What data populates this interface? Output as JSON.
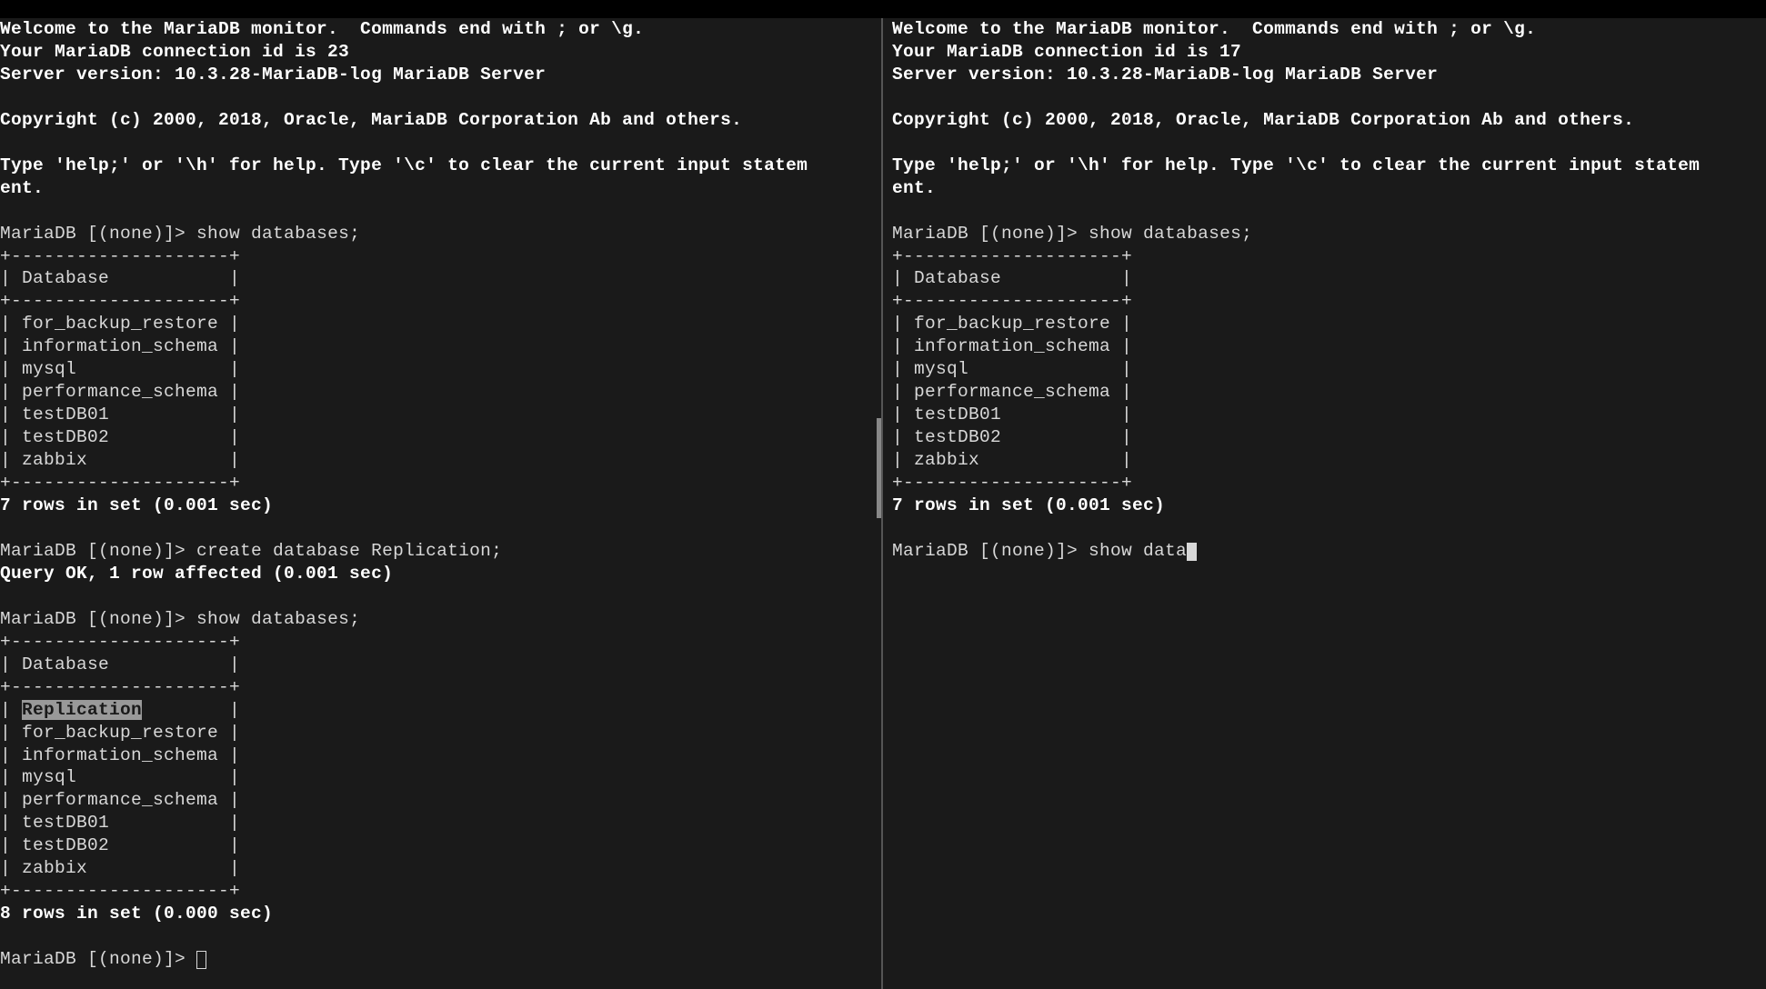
{
  "left": {
    "welcome_line": "Welcome to the MariaDB monitor.  Commands end with ; or \\g.",
    "conn_line": "Your MariaDB connection id is 23",
    "server_line": "Server version: 10.3.28-MariaDB-log MariaDB Server",
    "copyright_line": "Copyright (c) 2000, 2018, Oracle, MariaDB Corporation Ab and others.",
    "help_line1": "Type 'help;' or '\\h' for help. Type '\\c' to clear the current input statem",
    "help_line2": "ent.",
    "prompt1": "MariaDB [(none)]> ",
    "cmd1": "show databases;",
    "table1": {
      "border": "+--------------------+",
      "header": "| Database           |",
      "rows": [
        "| for_backup_restore |",
        "| information_schema |",
        "| mysql              |",
        "| performance_schema |",
        "| testDB01           |",
        "| testDB02           |",
        "| zabbix             |"
      ]
    },
    "result1": "7 rows in set (0.001 sec)",
    "prompt2": "MariaDB [(none)]> ",
    "cmd2": "create database Replication;",
    "result2": "Query OK, 1 row affected (0.001 sec)",
    "prompt3": "MariaDB [(none)]> ",
    "cmd3": "show databases;",
    "table2": {
      "border": "+--------------------+",
      "header": "| Database           |",
      "row_prefix": "| ",
      "highlighted_db": "Replication",
      "row_suffix_replication": "        |",
      "rows": [
        "| for_backup_restore |",
        "| information_schema |",
        "| mysql              |",
        "| performance_schema |",
        "| testDB01           |",
        "| testDB02           |",
        "| zabbix             |"
      ]
    },
    "result3": "8 rows in set (0.000 sec)",
    "prompt4": "MariaDB [(none)]> "
  },
  "right": {
    "welcome_line": "Welcome to the MariaDB monitor.  Commands end with ; or \\g.",
    "conn_line": "Your MariaDB connection id is 17",
    "server_line": "Server version: 10.3.28-MariaDB-log MariaDB Server",
    "copyright_line": "Copyright (c) 2000, 2018, Oracle, MariaDB Corporation Ab and others.",
    "help_line1": "Type 'help;' or '\\h' for help. Type '\\c' to clear the current input statem",
    "help_line2": "ent.",
    "prompt1": "MariaDB [(none)]> ",
    "cmd1": "show databases;",
    "table1": {
      "border": "+--------------------+",
      "header": "| Database           |",
      "rows": [
        "| for_backup_restore |",
        "| information_schema |",
        "| mysql              |",
        "| performance_schema |",
        "| testDB01           |",
        "| testDB02           |",
        "| zabbix             |"
      ]
    },
    "result1": "7 rows in set (0.001 sec)",
    "prompt2": "MariaDB [(none)]> ",
    "cmd2_partial": "show data"
  }
}
